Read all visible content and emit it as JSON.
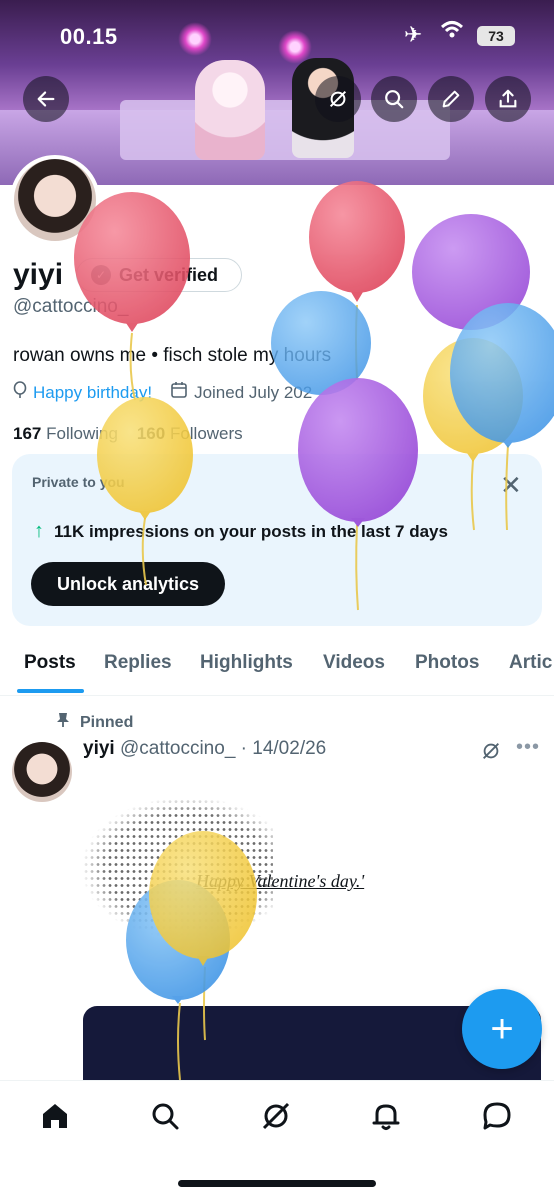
{
  "status_bar": {
    "time": "00.15",
    "battery": "73"
  },
  "header_actions": [
    "back-icon",
    "grok-icon",
    "search-icon",
    "edit-icon",
    "share-icon"
  ],
  "profile": {
    "name": "yiyi",
    "verify_label": "Get verified",
    "handle": "@cattoccino_",
    "bio": "rowan owns me • fisch stole my hours",
    "birthday": "Happy birthday!",
    "joined": "Joined July 202",
    "following_count": "167",
    "following_label": "Following",
    "followers_count": "160",
    "followers_label": "Followers"
  },
  "analytics_card": {
    "private_label": "Private to you",
    "impressions_text": "11K impressions on your posts in the last 7 days",
    "unlock_label": "Unlock analytics"
  },
  "tabs": [
    {
      "label": "Posts",
      "active": true
    },
    {
      "label": "Replies"
    },
    {
      "label": "Highlights"
    },
    {
      "label": "Videos"
    },
    {
      "label": "Photos"
    },
    {
      "label": "Artic"
    }
  ],
  "post": {
    "pinned_label": "Pinned",
    "author": "yiyi",
    "handle_date": "@cattoccino_ · 14/02/26",
    "text": "Happy Valentine's day.'"
  },
  "colors": {
    "accent": "#1d9bf0",
    "positive": "#00ba7c",
    "card_bg": "#eaf5fd"
  }
}
